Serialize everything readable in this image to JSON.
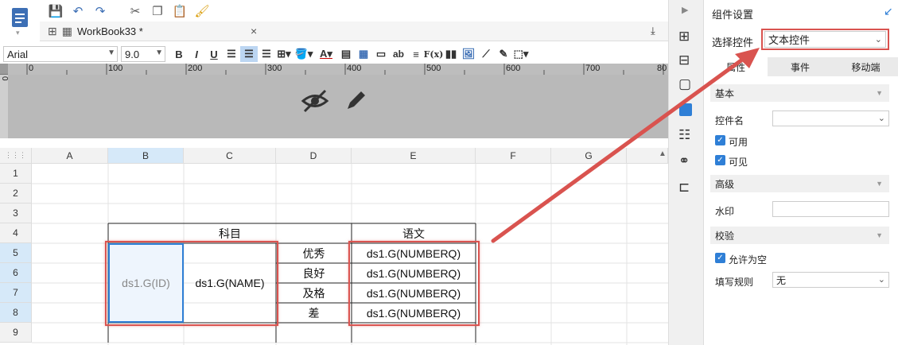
{
  "toolbar": {
    "font": "Arial",
    "size": "9.0",
    "bold": "B",
    "italic": "I",
    "underline": "U",
    "text_tool": "ab",
    "formula": "F(x)"
  },
  "tab": {
    "title": "WorkBook33 *",
    "close": "×"
  },
  "ruler": {
    "ticks": [
      "0",
      "100",
      "200",
      "300",
      "400",
      "500",
      "600",
      "700",
      "80"
    ],
    "left_mark": "0"
  },
  "grid": {
    "columns": [
      "A",
      "B",
      "C",
      "D",
      "E",
      "F",
      "G"
    ],
    "rows": [
      "1",
      "2",
      "3",
      "4",
      "5",
      "6",
      "7",
      "8",
      "9"
    ],
    "cells": {
      "subject": "科目",
      "chinese": "语文",
      "id": "ds1.G(ID)",
      "name": "ds1.G(NAME)",
      "grades": [
        "优秀",
        "良好",
        "及格",
        "差"
      ],
      "num": [
        "ds1.G(NUMBERQ)",
        "ds1.G(NUMBERQ)",
        "ds1.G(NUMBERQ)",
        "ds1.G(NUMBERQ)"
      ]
    }
  },
  "panel": {
    "title": "组件设置",
    "select_label": "选择控件",
    "select_value": "文本控件",
    "tabs": [
      "属性",
      "事件",
      "移动端"
    ],
    "sec_basic": "基本",
    "name_label": "控件名",
    "enabled": "可用",
    "visible": "可见",
    "sec_adv": "高级",
    "watermark": "水印",
    "sec_valid": "校验",
    "allow_empty": "允许为空",
    "fill_rule": "填写规则",
    "fill_rule_value": "无"
  },
  "colors": {
    "accent": "#2f7fd6",
    "highlight_red": "#d9534f"
  }
}
